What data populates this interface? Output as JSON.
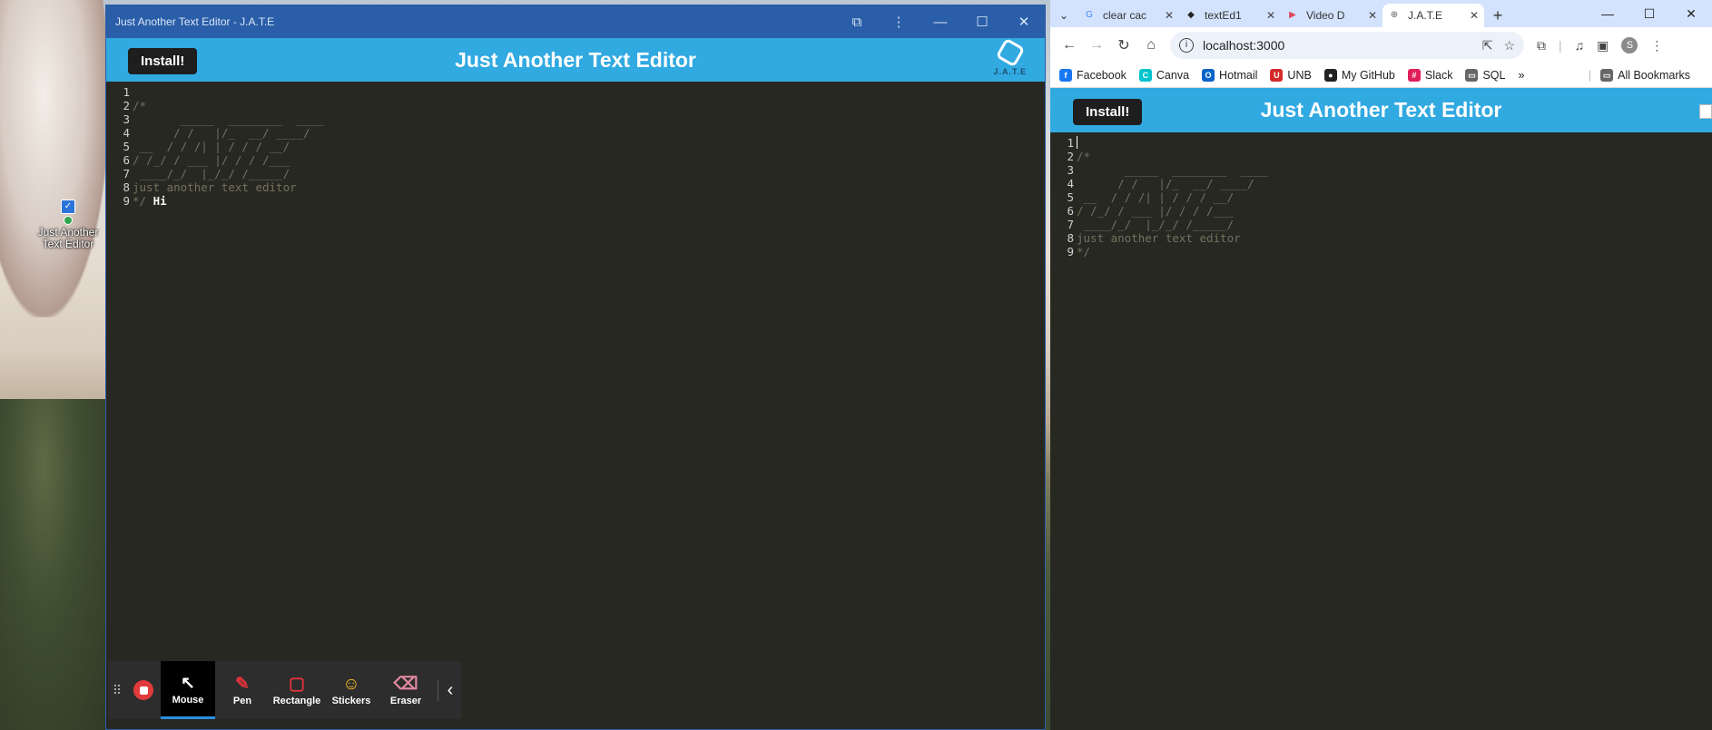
{
  "desktop": {
    "icon_label": "Just Another Text Editor"
  },
  "pwa_window": {
    "title": "Just Another Text Editor - J.A.T.E",
    "install_label": "Install!",
    "header_title": "Just Another Text Editor",
    "logo_text": "J.A.T.E",
    "editor_lines": [
      {
        "num": "1",
        "text": "",
        "extra": ""
      },
      {
        "num": "2",
        "text": "/*",
        "extra": ""
      },
      {
        "num": "3",
        "text": "       _____  ________  ____",
        "extra": ""
      },
      {
        "num": "4",
        "text": "      / /   |/_  __/ ____/",
        "extra": ""
      },
      {
        "num": "5",
        "text": " __  / / /| | / / / __/",
        "extra": ""
      },
      {
        "num": "6",
        "text": "/ /_/ / ___ |/ / / /___",
        "extra": ""
      },
      {
        "num": "7",
        "text": " ____/_/  |_/_/ /_____/",
        "extra": ""
      },
      {
        "num": "8",
        "text": "just another text editor",
        "extra": ""
      },
      {
        "num": "9",
        "text": "*/ ",
        "extra": "Hi"
      }
    ]
  },
  "annotation_toolbar": {
    "tools": [
      {
        "label": "Mouse",
        "icon": "cursor-icon",
        "glyph": "↖",
        "active": true
      },
      {
        "label": "Pen",
        "icon": "pen-icon",
        "glyph": "✎",
        "active": false
      },
      {
        "label": "Rectangle",
        "icon": "rectangle-icon",
        "glyph": "▢",
        "active": false
      },
      {
        "label": "Stickers",
        "icon": "sticker-icon",
        "glyph": "☺",
        "active": false
      },
      {
        "label": "Eraser",
        "icon": "eraser-icon",
        "glyph": "⌫",
        "active": false
      }
    ]
  },
  "browser": {
    "tabs": [
      {
        "title": "clear cac",
        "icon": "google-icon",
        "fav": "G",
        "color": "#4285f4",
        "active": false
      },
      {
        "title": "textEd1",
        "icon": "app-icon",
        "fav": "◆",
        "color": "#222222",
        "active": false
      },
      {
        "title": "Video D",
        "icon": "video-icon",
        "fav": "▶",
        "color": "#e0475a",
        "active": false
      },
      {
        "title": "J.A.T.E",
        "icon": "globe-icon",
        "fav": "⊕",
        "color": "#5f6368",
        "active": true
      }
    ],
    "url": "localhost:3000",
    "bookmarks": [
      {
        "label": "Facebook",
        "icon": "facebook-icon",
        "fav": "f",
        "color": "#1877f2"
      },
      {
        "label": "Canva",
        "icon": "canva-icon",
        "fav": "C",
        "color": "#00c4cc"
      },
      {
        "label": "Hotmail",
        "icon": "outlook-icon",
        "fav": "O",
        "color": "#0a64c8"
      },
      {
        "label": "UNB",
        "icon": "unb-icon",
        "fav": "U",
        "color": "#d42a2a"
      },
      {
        "label": "My GitHub",
        "icon": "github-icon",
        "fav": "●",
        "color": "#222222"
      },
      {
        "label": "Slack",
        "icon": "slack-icon",
        "fav": "#",
        "color": "#e01e5a"
      },
      {
        "label": "SQL",
        "icon": "folder-icon",
        "fav": "▭",
        "color": "#666666"
      }
    ],
    "all_bookmarks_label": "All Bookmarks",
    "avatar_letter": "S",
    "install_label": "Install!",
    "header_title": "Just Another Text Editor",
    "editor_lines": [
      {
        "num": "1",
        "text": ""
      },
      {
        "num": "2",
        "text": "/*"
      },
      {
        "num": "3",
        "text": "       _____  ________  ____"
      },
      {
        "num": "4",
        "text": "      / /   |/_  __/ ____/"
      },
      {
        "num": "5",
        "text": " __  / / /| | / / / __/"
      },
      {
        "num": "6",
        "text": "/ /_/ / ___ |/ / / /___"
      },
      {
        "num": "7",
        "text": " ____/_/  |_/_/ /_____/"
      },
      {
        "num": "8",
        "text": "just another text editor"
      },
      {
        "num": "9",
        "text": "*/"
      }
    ]
  }
}
